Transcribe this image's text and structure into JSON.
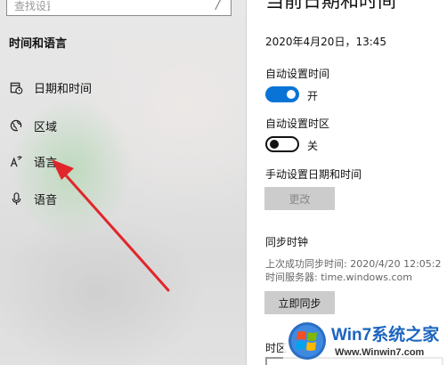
{
  "sidebar": {
    "search": {
      "placeholder": "查找设置"
    },
    "section_title": "时间和语言",
    "items": [
      {
        "label": "日期和时间",
        "icon": "calendar-clock-icon"
      },
      {
        "label": "区域",
        "icon": "globe-icon"
      },
      {
        "label": "语言",
        "icon": "language-icon"
      },
      {
        "label": "语音",
        "icon": "microphone-icon"
      }
    ]
  },
  "main": {
    "title": "当前日期和时间",
    "current_datetime": "2020年4月20日，13:45",
    "auto_time": {
      "label": "自动设置时间",
      "state": "开",
      "on": true
    },
    "auto_timezone": {
      "label": "自动设置时区",
      "state": "关",
      "on": false
    },
    "manual": {
      "label": "手动设置日期和时间",
      "button": "更改"
    },
    "sync": {
      "heading": "同步时钟",
      "last_sync": "上次成功同步时间: 2020/4/20 12:05:2",
      "server": "时间服务器: time.windows.com",
      "button": "立即同步"
    },
    "timezone": {
      "heading": "时区"
    }
  },
  "watermark": {
    "brand": "Win7系统之家",
    "url": "Www.Winwin7.com"
  },
  "colors": {
    "accent": "#0a74d6",
    "annotation": "#e0262a",
    "watermark_blue": "#1b64c0"
  }
}
